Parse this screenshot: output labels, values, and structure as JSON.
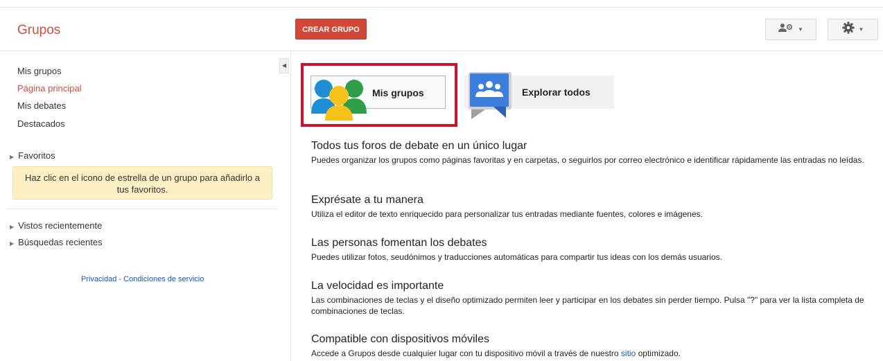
{
  "header": {
    "logo": "Grupos",
    "create_button": "CREAR GRUPO"
  },
  "sidebar": {
    "nav": [
      "Mis grupos",
      "Página principal",
      "Mis debates",
      "Destacados"
    ],
    "active_index": 1,
    "favorites_label": "Favoritos",
    "favorites_note": "Haz clic en el icono de estrella de un grupo para añadirlo a tus favoritos.",
    "recent_views": "Vistos recientemente",
    "recent_searches": "Búsquedas recientes",
    "footer": {
      "privacy": "Privacidad",
      "separator": "-",
      "terms": "Condiciones de servicio"
    }
  },
  "cards": {
    "my_groups": "Mis grupos",
    "explore": "Explorar todos"
  },
  "features": [
    {
      "title": "Todos tus foros de debate en un único lugar",
      "body": "Puedes organizar los grupos como páginas favoritas y en carpetas, o seguirlos por correo electrónico e identificar rápidamente las entradas no leídas."
    },
    {
      "title": "Exprésate a tu manera",
      "body": "Utiliza el editor de texto enriquecido para personalizar tus entradas mediante fuentes, colores e imágenes."
    },
    {
      "title": "Las personas fomentan los debates",
      "body": "Puedes utilizar fotos, seudónimos y traducciones automáticas para compartir tus ideas con los demás usuarios."
    },
    {
      "title": "La velocidad es importante",
      "body": "Las combinaciones de teclas y el diseño optimizado permiten leer y participar en los debates sin perder tiempo. Pulsa \"?\" para ver la lista completa de combinaciones de teclas."
    },
    {
      "title": "Compatible con dispositivos móviles",
      "body_before": "Accede a Grupos desde cualquier lugar con tu dispositivo móvil a través de nuestro ",
      "body_link": "sitio",
      "body_after": " optimizado."
    }
  ],
  "colors": {
    "brand_red": "#dd4b39",
    "highlight": "#d0112b",
    "link": "#1155cc"
  },
  "icons": [
    "people-settings-icon",
    "gear-icon",
    "chevron-down-icon",
    "collapse-arrow-icon",
    "my-groups-people-icon",
    "explore-groups-icon"
  ]
}
